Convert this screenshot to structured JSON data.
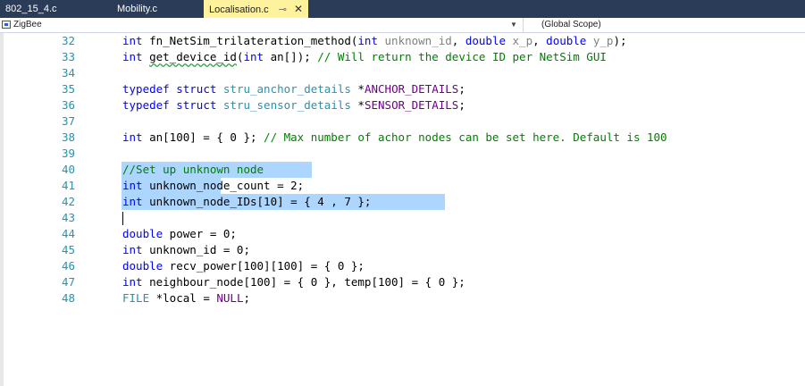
{
  "tabs": [
    {
      "label": "802_15_4.c",
      "active": false
    },
    {
      "label": "Mobility.c",
      "active": false
    },
    {
      "label": "Localisation.c",
      "active": true,
      "pin_icon": "pin-icon",
      "close_glyph": "✕"
    }
  ],
  "nav": {
    "project": "ZigBee",
    "scope": "(Global Scope)",
    "project_icon": "project-icon",
    "dropdown_icon": "chevron-down-icon"
  },
  "editor": {
    "lines": [
      {
        "n": "32",
        "tokens": [
          [
            "int",
            "kw"
          ],
          [
            " fn_NetSim_trilateration_method(",
            "pl"
          ],
          [
            "int",
            "kw"
          ],
          [
            " ",
            "pl"
          ],
          [
            "unknown_id",
            "par"
          ],
          [
            ", ",
            "pl"
          ],
          [
            "double",
            "kw"
          ],
          [
            " ",
            "pl"
          ],
          [
            "x_p",
            "par"
          ],
          [
            ", ",
            "pl"
          ],
          [
            "double",
            "kw"
          ],
          [
            " ",
            "pl"
          ],
          [
            "y_p",
            "par"
          ],
          [
            ");",
            "pl"
          ]
        ]
      },
      {
        "n": "33",
        "tokens": [
          [
            "int",
            "kw"
          ],
          [
            " ",
            "pl"
          ],
          [
            "get_device_id",
            "pl squiggle"
          ],
          [
            "(",
            "pl"
          ],
          [
            "int",
            "kw"
          ],
          [
            " an[]); ",
            "pl"
          ],
          [
            "// Will return the device ID per NetSim GUI",
            "cm"
          ]
        ]
      },
      {
        "n": "34",
        "tokens": []
      },
      {
        "n": "35",
        "tokens": [
          [
            "typedef",
            "kw"
          ],
          [
            " ",
            "pl"
          ],
          [
            "struct",
            "kw"
          ],
          [
            " ",
            "pl"
          ],
          [
            "stru_anchor_details",
            "ty"
          ],
          [
            " *",
            "pl"
          ],
          [
            "ANCHOR_DETAILS",
            "mac"
          ],
          [
            ";",
            "pl"
          ]
        ]
      },
      {
        "n": "36",
        "tokens": [
          [
            "typedef",
            "kw"
          ],
          [
            " ",
            "pl"
          ],
          [
            "struct",
            "kw"
          ],
          [
            " ",
            "pl"
          ],
          [
            "stru_sensor_details",
            "ty"
          ],
          [
            " *",
            "pl"
          ],
          [
            "SENSOR_DETAILS",
            "mac"
          ],
          [
            ";",
            "pl"
          ]
        ]
      },
      {
        "n": "37",
        "tokens": []
      },
      {
        "n": "38",
        "tokens": [
          [
            "int",
            "kw"
          ],
          [
            " an[100] = { 0 }; ",
            "pl"
          ],
          [
            "// Max number of achor nodes can be set here. Default is 100",
            "cm"
          ]
        ]
      },
      {
        "n": "39",
        "tokens": []
      },
      {
        "n": "40",
        "tokens": [
          [
            "//Set up unknown node",
            "cm"
          ]
        ],
        "selected": true
      },
      {
        "n": "41",
        "tokens": [
          [
            "int",
            "kw"
          ],
          [
            " unknown_node_count = 2;",
            "pl"
          ]
        ],
        "selected": true
      },
      {
        "n": "42",
        "tokens": [
          [
            "int",
            "kw"
          ],
          [
            " unknown_node_IDs[10] = { 4 , 7 };",
            "pl"
          ]
        ],
        "selected": true
      },
      {
        "n": "43",
        "tokens": [],
        "caret": true
      },
      {
        "n": "44",
        "tokens": [
          [
            "double",
            "kw"
          ],
          [
            " power = 0;",
            "pl"
          ]
        ]
      },
      {
        "n": "45",
        "tokens": [
          [
            "int",
            "kw"
          ],
          [
            " unknown_id = 0;",
            "pl"
          ]
        ]
      },
      {
        "n": "46",
        "tokens": [
          [
            "double",
            "kw"
          ],
          [
            " recv_power[100][100] = { 0 };",
            "pl"
          ]
        ]
      },
      {
        "n": "47",
        "tokens": [
          [
            "int",
            "kw"
          ],
          [
            " neighbour_node[100] = { 0 }, temp[100] = { 0 };",
            "pl"
          ]
        ]
      },
      {
        "n": "48",
        "tokens": [
          [
            "FILE",
            "ty"
          ],
          [
            " *local = ",
            "pl"
          ],
          [
            "NULL",
            "mac"
          ],
          [
            ";",
            "pl"
          ]
        ]
      }
    ]
  },
  "colors": {
    "tab_strip": "#2b3c59",
    "active_tab": "#fff29d",
    "selection": "#add6ff",
    "keyword": "#0000ff",
    "comment": "#008000",
    "line_number": "#2b91af",
    "macro": "#6f008a"
  }
}
